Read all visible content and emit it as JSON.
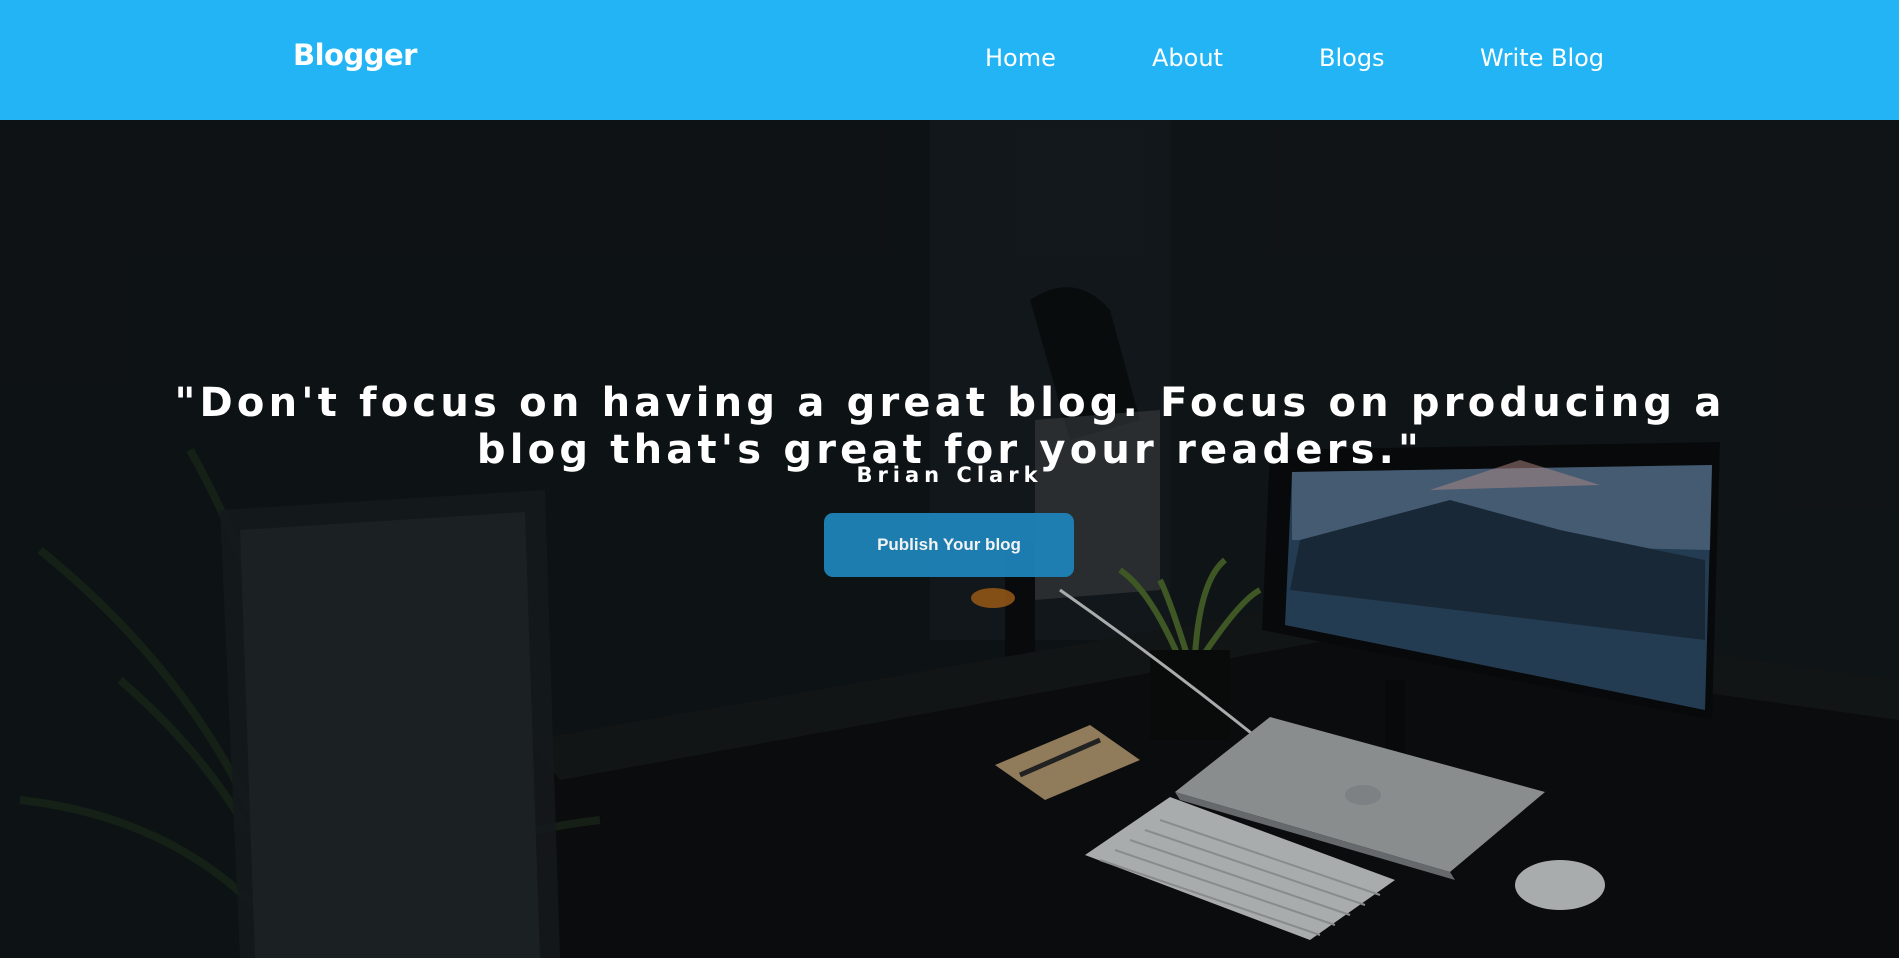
{
  "nav": {
    "brand": "Blogger",
    "links": [
      {
        "label": "Home"
      },
      {
        "label": "About"
      },
      {
        "label": "Blogs"
      },
      {
        "label": "Write Blog"
      }
    ]
  },
  "hero": {
    "quote": "\"Don't focus on having a great blog. Focus on producing a blog that's great for your readers.\"",
    "author": "Brian Clark",
    "button_label": "Publish Your blog"
  },
  "colors": {
    "navbar": "#22b4f5",
    "button": "#1f83b8",
    "text": "#ffffff"
  }
}
